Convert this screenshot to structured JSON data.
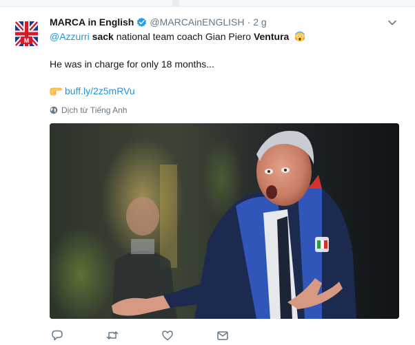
{
  "tweet": {
    "author_name": "MARCA in English",
    "handle": "@MARCAinENGLISH",
    "separator": "·",
    "time": "2 g",
    "text": {
      "mention": "@Azzurri",
      "bold1": "sack",
      "middle": " national team coach Gian Piero ",
      "bold2": "Ventura",
      "line2": "He was in charge for only 18 months...",
      "link": "buff.ly/2z5mRVu"
    },
    "translate_label": "Dịch từ Tiếng Anh"
  },
  "icons": {
    "verified": "verified-badge-icon",
    "caret": "chevron-down-icon",
    "emoji": "screaming-face-emoji",
    "pointer": "pointing-hand-emoji",
    "globe": "globe-icon",
    "reply": "reply-icon",
    "retweet": "retweet-icon",
    "like": "heart-icon",
    "message": "envelope-icon"
  },
  "colors": {
    "link": "#1b95e0",
    "secondary_text": "#657786",
    "primary_text": "#14171a"
  }
}
